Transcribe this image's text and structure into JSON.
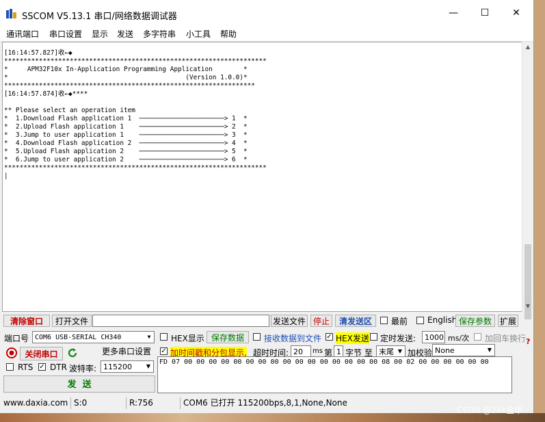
{
  "window": {
    "title": "SSCOM V5.13.1 串口/网络数据调试器",
    "minimize_glyph": "—",
    "maximize_glyph": "☐",
    "close_glyph": "✕"
  },
  "menu": [
    "通讯端口",
    "串口设置",
    "显示",
    "发送",
    "多字符串",
    "小工具",
    "帮助"
  ],
  "terminal": {
    "lines": [
      "[16:14:57.827]收←◆",
      "********************************************************************",
      "*     APM32F10x In-Application Programming Application        *",
      "*                                              (Version 1.0.0)*",
      "*****************************************************************",
      "[16:14:57.874]收←◆****",
      "",
      "** Please select an operation item",
      "*  1.Download Flash application 1  ──────────────────────> 1  *",
      "*  2.Upload Flash application 1    ──────────────────────> 2  *",
      "*  3.Jump to user application 1    ──────────────────────> 3  *",
      "*  4.Download Flash application 2  ──────────────────────> 4  *",
      "*  5.Upload Flash application 2    ──────────────────────> 5  *",
      "*  6.Jump to user application 2    ──────────────────────> 6  *",
      "********************************************************************",
      "|"
    ]
  },
  "toolbar1": {
    "clear_window": "清除窗口",
    "open_file": "打开文件",
    "send_file": "发送文件",
    "stop": "停止",
    "clear_send": "清发送区",
    "topmost": "最前",
    "english": "English",
    "save_params": "保存参数",
    "expand": "扩展"
  },
  "port": {
    "label": "端口号",
    "value": "COM6 USB-SERIAL CH340",
    "hex_display": "HEX显示",
    "save_data": "保存数据",
    "recv_to_file": "接收数据到文件",
    "hex_send": "HEX发送",
    "timed_send": "定时发送:",
    "interval": "1000",
    "interval_unit": "ms/次",
    "add_crlf": "加回车换行"
  },
  "row3": {
    "close_port": "关闭串口",
    "more_settings": "更多串口设置",
    "timestamp": "加时间戳和分包显示,",
    "timeout_label": "超时时间:",
    "timeout_value": "20",
    "timeout_unit": "ms",
    "nth": "第",
    "byte_index": "1",
    "byte_label": "字节 至",
    "tail": "末尾",
    "checksum_label": "加校验",
    "checksum_value": "None",
    "help": "?"
  },
  "row4": {
    "rts": "RTS",
    "dtr": "DTR",
    "baud_label": "波特率:",
    "baud_value": "115200"
  },
  "send": {
    "button": "发  送",
    "content": "FD 07 00 00 00 00 00 00 00 00 00 00 00 00 00 00 00 00  08 00 02 00 00 00 00 00 00"
  },
  "status": {
    "site": "www.daxia.com",
    "sent": "S:0",
    "received": "R:756",
    "port_state": "COM6 已打开  115200bps,8,1,None,None"
  },
  "watermark": "CSDN @24k金甲",
  "colors": {
    "accent_red": "#c00000",
    "accent_green": "#007a00",
    "highlight": "#ffff00"
  }
}
